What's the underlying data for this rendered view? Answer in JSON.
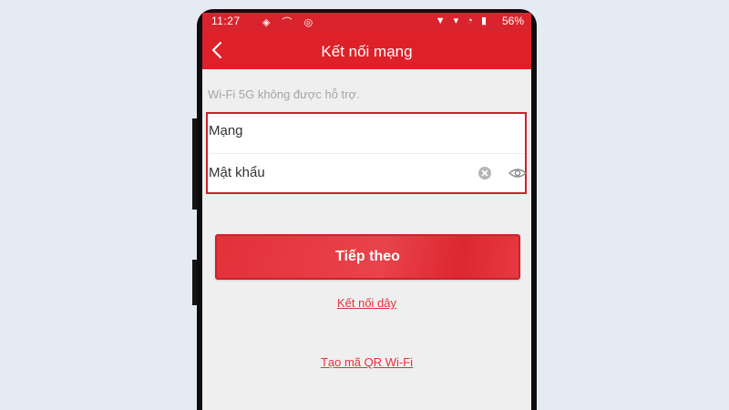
{
  "status_bar": {
    "time": "11:27",
    "left_icons": "◈ ⌒ ◎",
    "right_icons": "▼ ▾ ◔ ▮",
    "battery": "56%"
  },
  "app_bar": {
    "back_icon": "chevron-left-icon",
    "title": "Kết nối mạng"
  },
  "notice": "Wi-Fi 5G không được hỗ trợ.",
  "form": {
    "network_label": "Mạng",
    "password_label": "Mật khẩu",
    "clear_icon": "clear-icon",
    "visibility_icon": "eye-icon"
  },
  "actions": {
    "next_label": "Tiếp theo",
    "wired_link": "Kết nối dây",
    "qr_link": "Tạo mã QR Wi-Fi"
  },
  "colors": {
    "accent": "#de2028",
    "background": "#e4ebf3",
    "screen": "#efefef",
    "highlight_border": "#c8222b",
    "link": "#e0333b"
  }
}
